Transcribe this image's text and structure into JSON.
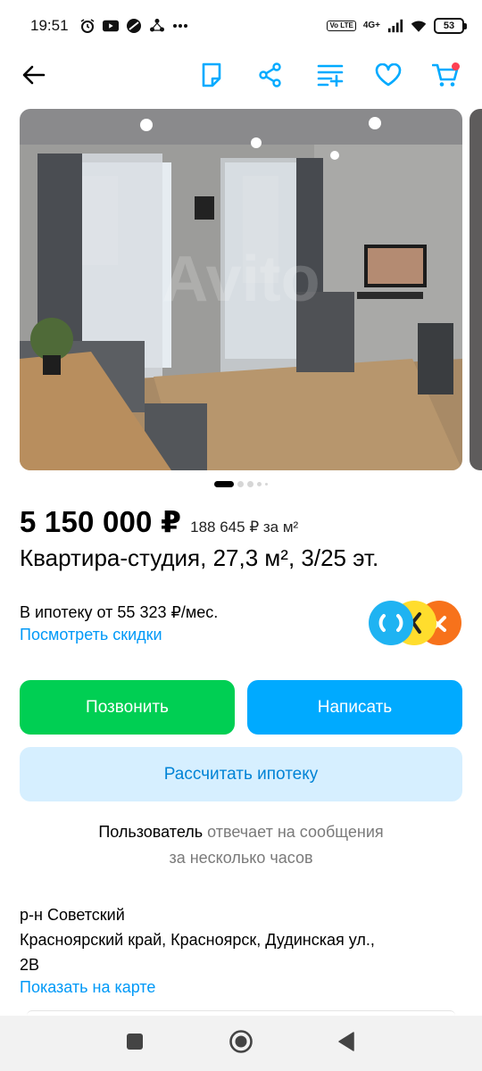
{
  "status_bar": {
    "time": "19:51",
    "network": "4G+",
    "volte": "Vo LTE",
    "battery": "53"
  },
  "toolbar": {
    "icons": [
      "back-arrow-icon",
      "note-icon",
      "share-icon",
      "compare-icon",
      "heart-icon",
      "cart-icon"
    ],
    "accent": "#00aaff"
  },
  "gallery": {
    "pages": 5,
    "active_page": 1,
    "watermark": "Avito"
  },
  "listing": {
    "price": "5 150 000 ₽",
    "price_per_m2": "188 645 ₽ за м²",
    "title": "Квартира-студия, 27,3 м², 3/25 эт."
  },
  "mortgage": {
    "text": "В ипотеку от 55 323 ₽/мес.",
    "discounts_link": "Посмотреть скидки"
  },
  "actions": {
    "call": "Позвонить",
    "write": "Написать",
    "calc": "Рассчитать ипотеку"
  },
  "seller": {
    "user": "Пользователь",
    "reply_line1": "отвечает на сообщения",
    "reply_line2": "за несколько часов"
  },
  "location": {
    "district": "р-н Советский",
    "address_line1": "Красноярский край, Красноярск, Дудинская ул.,",
    "address_line2": "2В",
    "map_link": "Показать на карте"
  },
  "colors": {
    "call_green": "#00cf53",
    "write_blue": "#00aaff",
    "calc_bg": "#d6efff",
    "link_blue": "#0099f7"
  }
}
